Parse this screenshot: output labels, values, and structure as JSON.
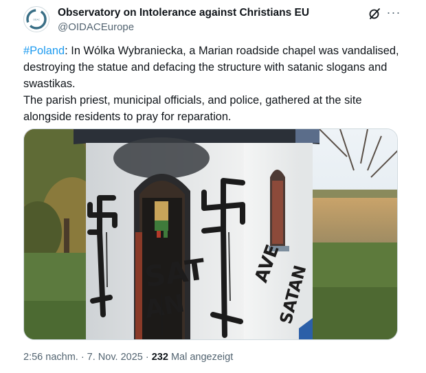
{
  "author": {
    "name": "Observatory on Intolerance against Christians EU",
    "handle": "@OIDACEurope",
    "avatar_icon": "oidac-logo-icon"
  },
  "header_icons": {
    "grok": "grok-icon",
    "more": "more-icon",
    "more_glyph": "···"
  },
  "post": {
    "hashtag": "#Poland",
    "line1_rest": ": In Wólka Wybraniecka, a Marian roadside chapel was vandalised, destroying the statue and defacing the structure with satanic slogans and swastikas.",
    "line2": "The parish priest, municipal officials, and police, gathered at the site alongside residents to pray for reparation."
  },
  "image": {
    "graffiti_left": "SAT",
    "graffiti_left2": "AN",
    "graffiti_right": "AVE",
    "graffiti_right2": "SATAN"
  },
  "meta": {
    "time": "2:56 nachm. · 7. Nov. 2025 · ",
    "views": "232",
    "views_label": " Mal angezeigt"
  }
}
